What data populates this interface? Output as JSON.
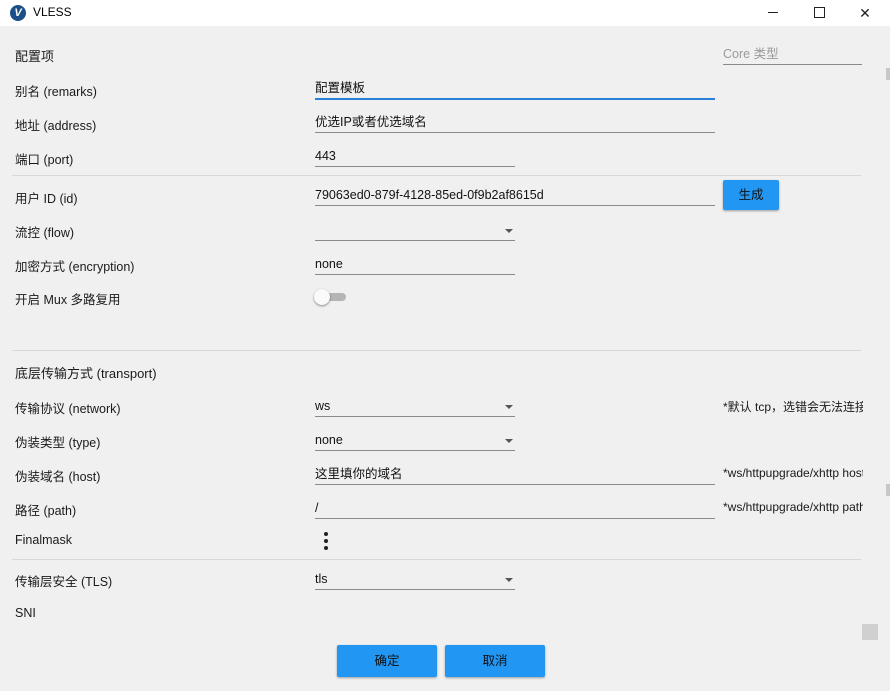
{
  "window": {
    "title": "VLESS",
    "icon_letter": "V"
  },
  "sections": {
    "config": "配置项",
    "transport": "底层传输方式 (transport)"
  },
  "core_type": {
    "placeholder": "Core 类型"
  },
  "fields": {
    "remarks": {
      "label": "别名 (remarks)",
      "value": "配置模板"
    },
    "address": {
      "label": "地址 (address)",
      "value": "优选IP或者优选域名"
    },
    "port": {
      "label": "端口 (port)",
      "value": "443"
    },
    "id": {
      "label": "用户 ID (id)",
      "value": "79063ed0-879f-4128-85ed-0f9b2af8615d"
    },
    "flow": {
      "label": "流控 (flow)",
      "value": ""
    },
    "encryption": {
      "label": "加密方式 (encryption)",
      "value": "none"
    },
    "mux": {
      "label": "开启 Mux 多路复用",
      "enabled": false
    },
    "network": {
      "label": "传输协议 (network)",
      "value": "ws",
      "hint": "*默认 tcp，选错会无法连接"
    },
    "type": {
      "label": "伪装类型 (type)",
      "value": "none"
    },
    "host": {
      "label": "伪装域名 (host)",
      "value": "这里填你的域名",
      "hint": "*ws/httpupgrade/xhttp host"
    },
    "path": {
      "label": "路径 (path)",
      "value": "/",
      "hint": "*ws/httpupgrade/xhttp path"
    },
    "finalmask": {
      "label": "Finalmask"
    },
    "tls": {
      "label": "传输层安全 (TLS)",
      "value": "tls"
    },
    "sni": {
      "label": "SNI"
    }
  },
  "buttons": {
    "generate": "生成",
    "ok": "确定",
    "cancel": "取消"
  },
  "colors": {
    "accent": "#2196f3",
    "focus_underline": "#2a7fd9"
  }
}
